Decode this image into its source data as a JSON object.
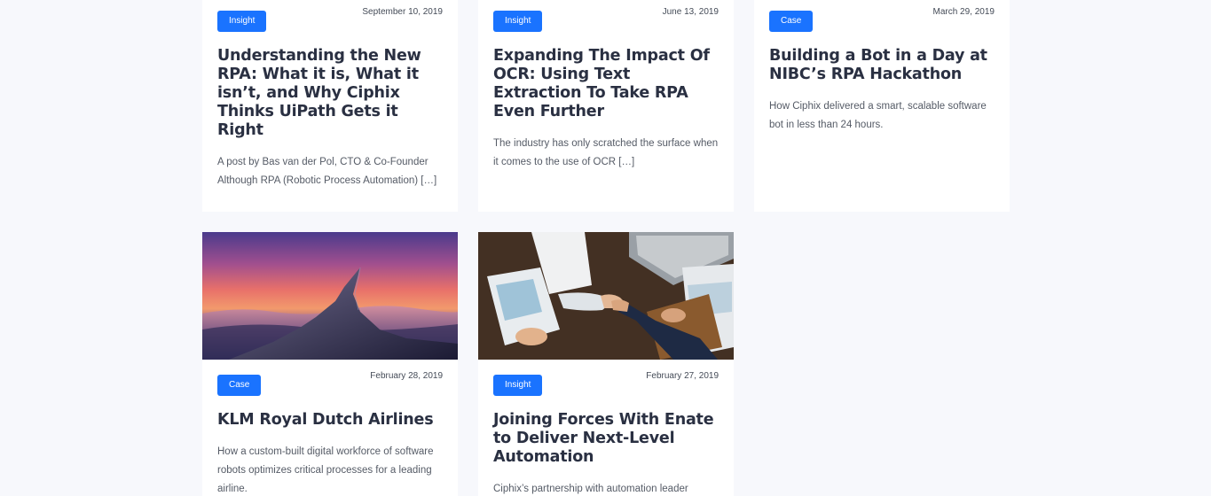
{
  "posts": [
    {
      "tag": "Insight",
      "date": "September 10, 2019",
      "title": "Understanding the New RPA: What it is, What it isn’t, and Why Ciphix Thinks UiPath Gets it Right",
      "excerpt": "A post by Bas van der Pol, CTO & Co-Founder Although RPA (Robotic Process Automation) […]"
    },
    {
      "tag": "Insight",
      "date": "June 13, 2019",
      "title": "Expanding The Impact Of OCR: Using Text Extraction To Take RPA Even Further",
      "excerpt": "The industry has only scratched the surface when it comes to the use of OCR […]"
    },
    {
      "tag": "Case",
      "date": "March 29, 2019",
      "title": "Building a Bot in a Day at NIBC’s RPA Hackathon",
      "excerpt": "How Ciphix delivered a smart, scalable software bot in less than 24 hours."
    },
    {
      "tag": "Case",
      "date": "February 28, 2019",
      "title": "KLM Royal Dutch Airlines",
      "excerpt": "How a custom-built digital workforce of software robots optimizes critical processes for a leading airline."
    },
    {
      "tag": "Insight",
      "date": "February 27, 2019",
      "title": "Joining Forces With Enate to Deliver Next-Level Automation",
      "excerpt": "Ciphix’s partnership with automation leader"
    }
  ],
  "colors": {
    "tag_background": "#1a73ff",
    "title": "#2a3042",
    "page_background": "#f7f8fc"
  }
}
